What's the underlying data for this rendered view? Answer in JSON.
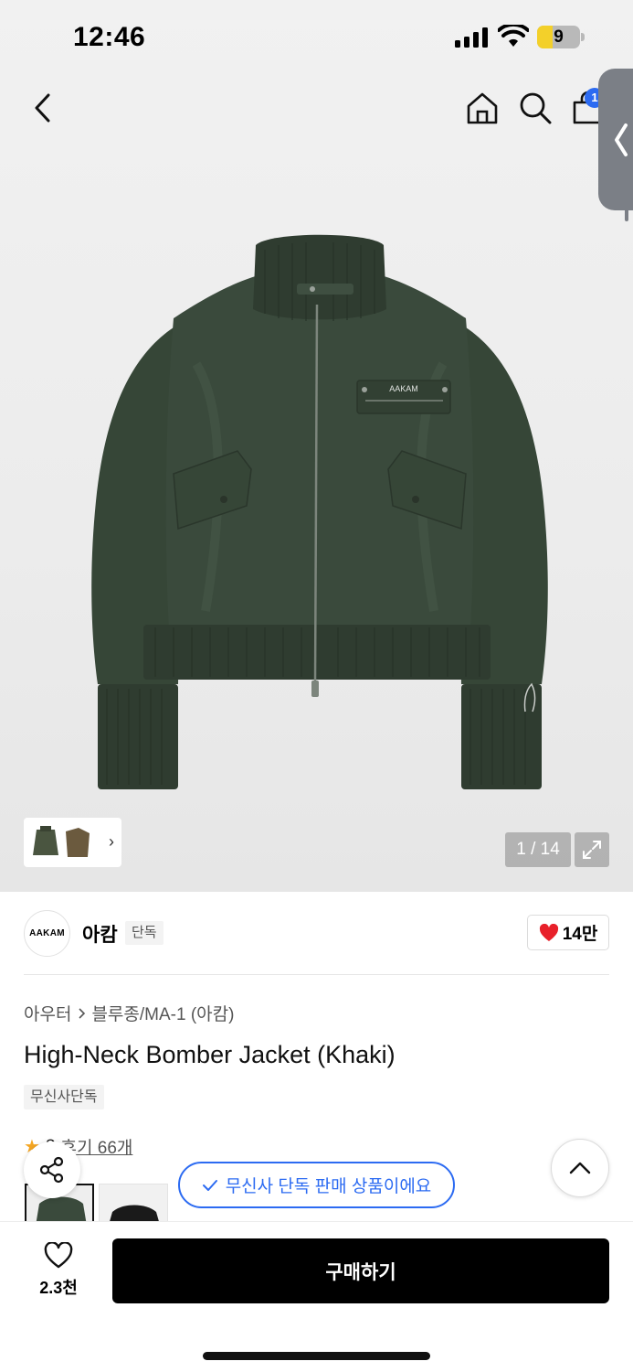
{
  "status_bar": {
    "time": "12:46",
    "battery_level": "9",
    "battery_fraction": 0.09
  },
  "nav": {
    "cart_badge": "1",
    "icons": [
      "back-chevron-icon",
      "home-icon",
      "search-icon",
      "bag-icon",
      "side-panel-chevron-icon"
    ]
  },
  "gallery": {
    "counter": "1 / 14",
    "brand_print": "AAKAM",
    "thumb_chevron": "›"
  },
  "brand": {
    "logo_text": "AAKAM",
    "name": "아캄",
    "badge": "단독",
    "likes": "14만"
  },
  "product": {
    "breadcrumb": [
      "아우터",
      "블루종/MA-1 (아캄)"
    ],
    "title": "High-Neck Bomber Jacket (Khaki)",
    "tag": "무신사단독",
    "rating_visible": "3",
    "review_link": "후기 66개"
  },
  "toast": {
    "text": "무신사 단독 판매 상품이에요"
  },
  "bottom": {
    "wish_count": "2.3천",
    "buy_label": "구매하기"
  },
  "colors": {
    "accent": "#2c6bf2",
    "jacket": "#3a4a3c",
    "heart": "#e8202a",
    "star": "#f5a623"
  }
}
